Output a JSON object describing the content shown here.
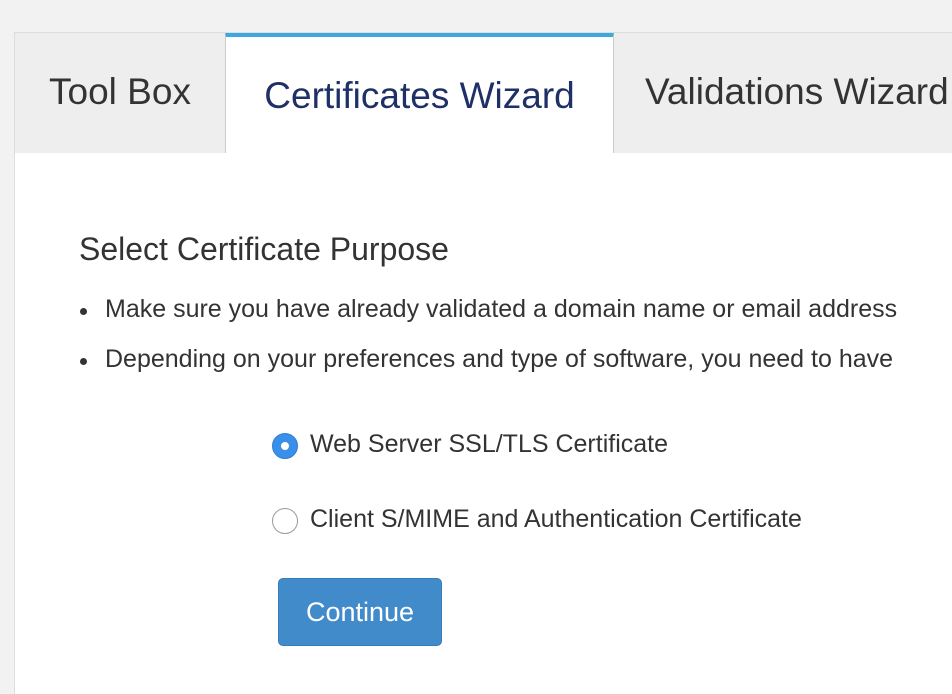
{
  "tabs": [
    {
      "label": "Tool Box",
      "active": false
    },
    {
      "label": "Certificates Wizard",
      "active": true
    },
    {
      "label": "Validations Wizard",
      "active": false
    }
  ],
  "section": {
    "title": "Select Certificate Purpose",
    "bullets": [
      "Make sure you have already validated a domain name or email address",
      "Depending on your preferences and type of software, you need to have"
    ]
  },
  "options": [
    {
      "label": "Web Server SSL/TLS Certificate",
      "selected": true
    },
    {
      "label": "Client S/MIME and Authentication Certificate",
      "selected": false
    }
  ],
  "actions": {
    "continue_label": "Continue"
  },
  "colors": {
    "active_tab_accent": "#3ca8de",
    "active_tab_text": "#1f3067",
    "button_bg": "#428bca",
    "radio_selected": "#3a8fe8"
  }
}
